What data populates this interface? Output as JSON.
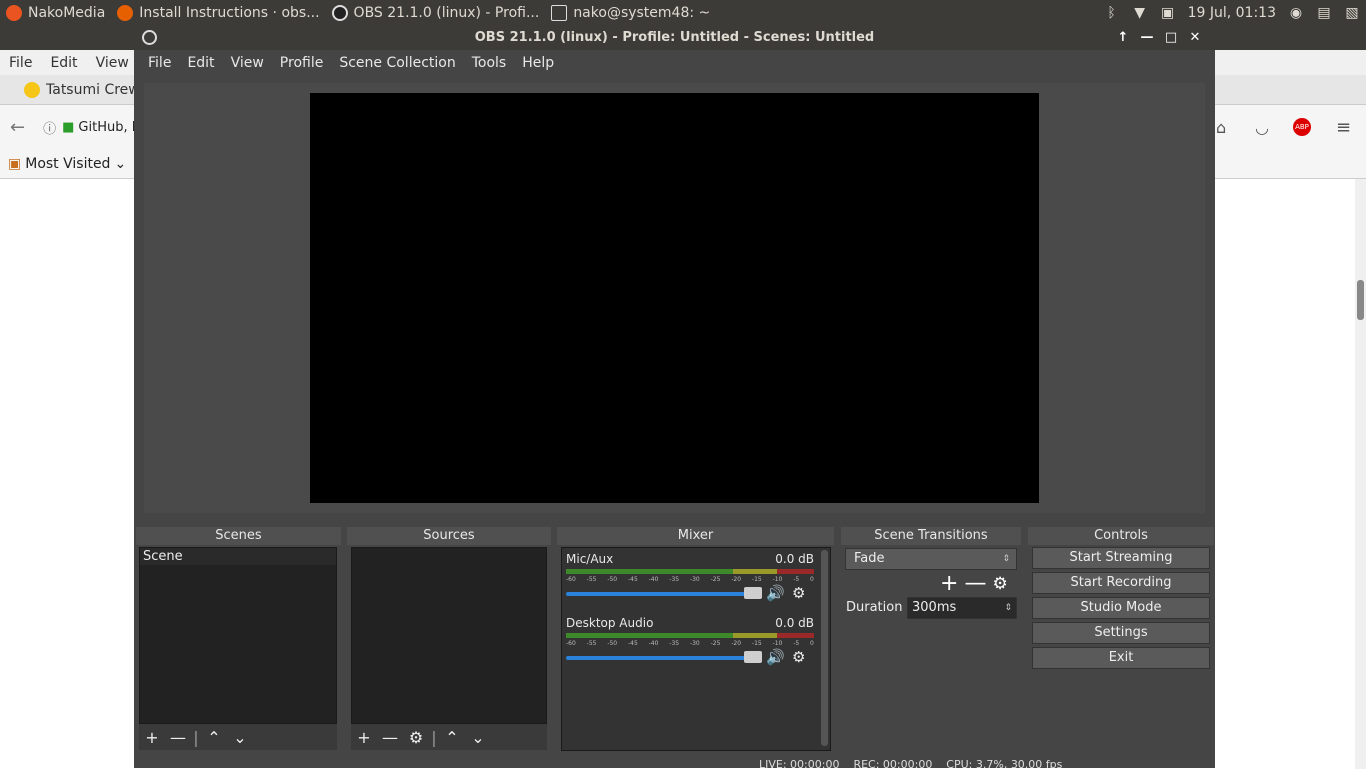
{
  "topbar": {
    "app1": "NakoMedia",
    "app2": "Install Instructions · obs...",
    "app3": "OBS 21.1.0 (linux) - Profi...",
    "app4": "nako@system48: ~",
    "clock": "19 Jul, 01:13"
  },
  "firefox": {
    "menu": [
      "File",
      "Edit",
      "View"
    ],
    "tab": "Tatsumi Crew",
    "url": "GitHub, In",
    "bookmark": "Most Visited"
  },
  "obs": {
    "title": "OBS 21.1.0 (linux) - Profile: Untitled - Scenes: Untitled",
    "menu": [
      "File",
      "Edit",
      "View",
      "Profile",
      "Scene Collection",
      "Tools",
      "Help"
    ],
    "docks": {
      "scenes": "Scenes",
      "sources": "Sources",
      "mixer": "Mixer",
      "transitions": "Scene Transitions",
      "controls": "Controls"
    },
    "scenes": [
      "Scene"
    ],
    "mixer": [
      {
        "name": "Mic/Aux",
        "db": "0.0 dB",
        "level": 1.0
      },
      {
        "name": "Desktop Audio",
        "db": "0.0 dB",
        "level": 1.0
      }
    ],
    "meter_ticks": [
      "-60",
      "-55",
      "-50",
      "-45",
      "-40",
      "-35",
      "-30",
      "-25",
      "-20",
      "-15",
      "-10",
      "-5",
      "0"
    ],
    "transition": "Fade",
    "duration_label": "Duration",
    "duration": "300ms",
    "controls": [
      "Start Streaming",
      "Start Recording",
      "Studio Mode",
      "Settings",
      "Exit"
    ],
    "status": "LIVE: 00:00:00    REC: 00:00:00    CPU: 3.7%, 30.00 fps"
  }
}
